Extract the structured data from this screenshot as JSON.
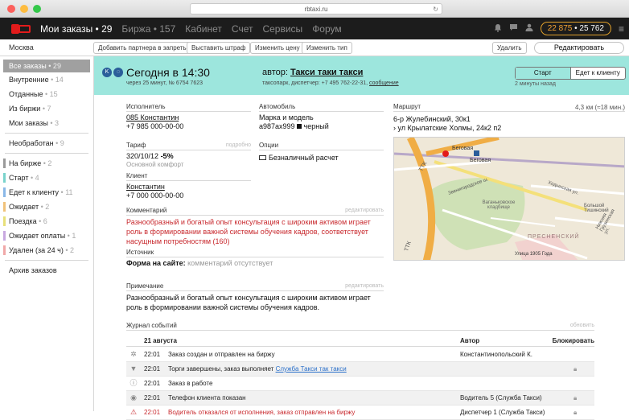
{
  "browser": {
    "url": "rbtaxi.ru"
  },
  "colors": {
    "brand": "#e21b1b",
    "accent": "#9de6dd",
    "balance": "#f3a334",
    "error": "#c8282d"
  },
  "nav": {
    "items": [
      {
        "label": "Мои заказы • 29"
      },
      {
        "label": "Биржа • 157"
      },
      {
        "label": "Кабинет"
      },
      {
        "label": "Счет"
      },
      {
        "label": "Сервисы"
      },
      {
        "label": "Форум"
      }
    ],
    "balance_main": "22 875",
    "balance_sep": " • ",
    "balance_second": "25 762"
  },
  "toolbar": {
    "city": "Москва",
    "add_partner": "Добавить партнера в запреты",
    "fine": "Выставить штраф",
    "change_price": "Изменить цену",
    "change_type": "Изменить тип",
    "delete": "Удалить",
    "edit": "Редактировать"
  },
  "sidebar": {
    "group1": [
      {
        "label": "Все заказы",
        "count": " • 29"
      },
      {
        "label": "Внутренние",
        "count": " • 14"
      },
      {
        "label": "Отданные",
        "count": " • 15"
      },
      {
        "label": "Из биржи",
        "count": " • 7"
      },
      {
        "label": "Мои заказы",
        "count": " • 3"
      }
    ],
    "group2": [
      {
        "label": "Необработан",
        "count": " • 9"
      }
    ],
    "statuses": [
      {
        "label": "На бирже",
        "count": " • 2",
        "color": "#9a9a9a"
      },
      {
        "label": "Старт",
        "count": " • 4",
        "color": "#7ad3cc"
      },
      {
        "label": "Едет к клиенту",
        "count": " • 11",
        "color": "#8ab8e8"
      },
      {
        "label": "Ожидает",
        "count": " • 2",
        "color": "#f0c27a"
      },
      {
        "label": "Поездка",
        "count": " • 6",
        "color": "#e8e07a"
      },
      {
        "label": "Ожидает оплаты",
        "count": " • 1",
        "color": "#c8a8e0"
      },
      {
        "label": "Удален (за 24 ч)",
        "count": " • 2",
        "color": "#f0a8a8"
      }
    ],
    "archive": "Архив заказов"
  },
  "order": {
    "title": "Сегодня в 14:30",
    "subtitle": "через 25 минут, № 6754 7623",
    "author_prefix": "автор: ",
    "author_name": "Такси таки такси",
    "author_sub": "таксопарк, диспетчер: +7 495 762-22-31, ",
    "author_link": "сообщение",
    "status_on": "Старт",
    "status_next": "Едет к клиенту",
    "status_time": "2 минуты назад"
  },
  "details": {
    "executor_label": "Исполнитель",
    "executor_name": "085 Константин",
    "executor_phone": "+7 985 000-00-00",
    "car_label": "Автомобиль",
    "car_model": "Марка и модель",
    "car_plate": "а987ах999",
    "car_color": "черный",
    "tariff_label": "Тариф",
    "tariff_hint": "подробно",
    "tariff_value": "320/10/12",
    "tariff_discount": "-5%",
    "tariff_class": "Основной комфорт",
    "options_label": "Опции",
    "option_value": "Безналичный расчет",
    "client_label": "Клиент",
    "client_name": "Константин",
    "client_phone": "+7 000 000-00-00",
    "route_label": "Маршрут",
    "route_meta": "4,3 км (≈18 мин.)",
    "route_from": "6-р Жулебинский, 30к1",
    "route_to": "ул Крылатские Холмы, 24к2 п2",
    "comment_label": "Комментарий",
    "comment_hint": "редактировать",
    "comment_text": "Разнообразный и богатый опыт консультация с широким активом играет роль в формировании важной системы обучения кадров, соответствует насущным потребностям (160)",
    "source_label": "Источник",
    "source_key": "Форма на сайте:",
    "source_value": " комментарий отсутствует",
    "note_label": "Примечание",
    "note_hint": "редактировать",
    "note_text": "Разнообразный и богатый опыт консультация с широким активом играет роль в формировании важной системы обучения кадров."
  },
  "map": {
    "labels": {
      "ttk": "ТТК",
      "ttk2": "ТТК",
      "begovaya": "Беговая",
      "begovaya2": "Беговая",
      "cemetery": "Ваганьковское кладбище",
      "presnensky": "ПРЕСНЕНСКИЙ",
      "street1905": "Улица 1905 Года",
      "khodynskaya": "Ходынская ул.",
      "bolshaya": "Большой Тишинский",
      "nizhnaya": "Нижняя Грузинская ул.",
      "zvenigorod": "Звенигородское ш."
    }
  },
  "journal": {
    "label": "Журнал событий",
    "refresh": "обновить",
    "date": "21 августа",
    "author_col": "Автор",
    "block_col": "Блокировать",
    "rows": [
      {
        "time": "22:01",
        "event": "Заказ создан и отправлен на биржу",
        "author": "Константинопольский К.",
        "icon": "gear-icon"
      },
      {
        "time": "22:01",
        "event": "Торги завершены, заказ выполняет ",
        "link": "Служба Такси так такси",
        "author": "",
        "icon": "gavel-icon"
      },
      {
        "time": "22:01",
        "event": "Заказ в работе",
        "author": "",
        "icon": "info-icon"
      },
      {
        "time": "22:01",
        "event": "Телефон клиента показан",
        "author": "Водитель 5 (Служба Такси)",
        "icon": "eye-icon"
      },
      {
        "time": "22:01",
        "event": "Водитель отказался от исполнения, заказ отправлен на биржу",
        "author": "Диспетчер 1 (Служба Такси)",
        "icon": "warning-icon"
      }
    ]
  }
}
